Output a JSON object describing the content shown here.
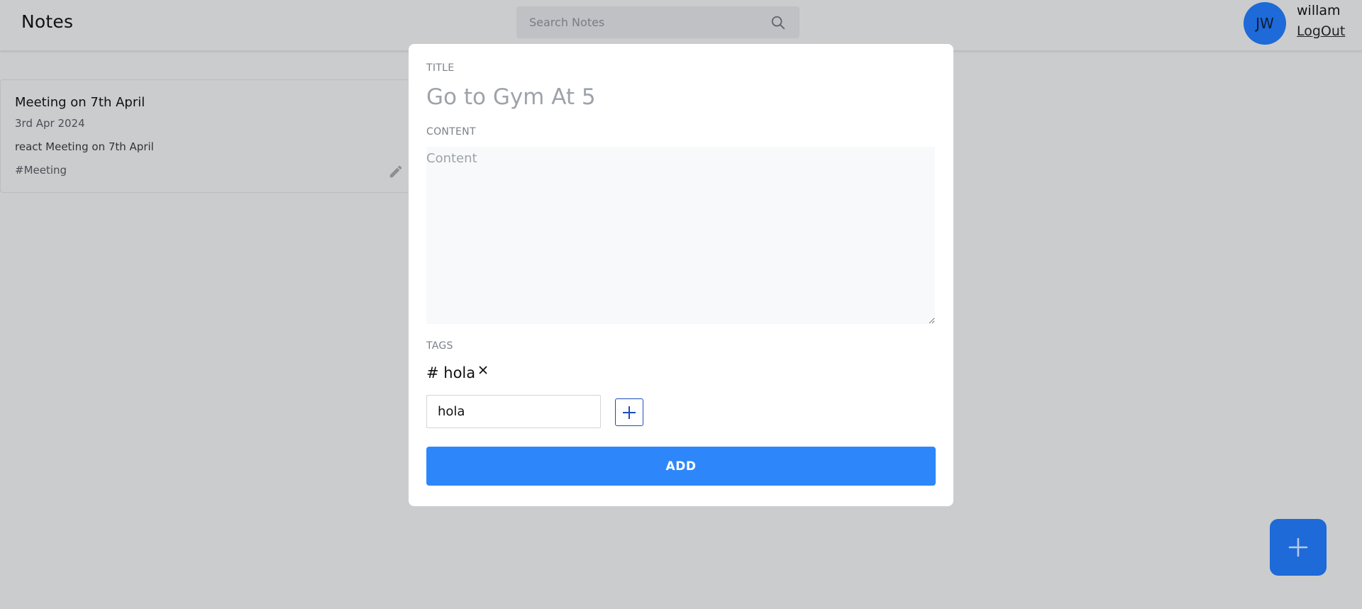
{
  "header": {
    "title": "Notes",
    "search_placeholder": "Search Notes",
    "avatar_initials": "JW",
    "user_name": "willam",
    "logout_label": "LogOut"
  },
  "notes": [
    {
      "title": "Meeting on 7th April",
      "date": "3rd Apr 2024",
      "content": "react Meeting on 7th April",
      "tags": "#Meeting"
    }
  ],
  "modal": {
    "title_label": "TITLE",
    "title_placeholder": "Go to Gym At 5",
    "content_label": "CONTENT",
    "content_placeholder": "Content",
    "tags_label": "TAGS",
    "tags": [
      "# hola"
    ],
    "tag_input_value": "hola",
    "add_label": "ADD"
  },
  "colors": {
    "accent": "#2d87fb",
    "avatar_bg": "#1d6ad8",
    "overlay_bg": "#cbcccd"
  },
  "icons": {
    "search": "search-icon",
    "edit": "pencil-icon",
    "tag_remove": "close-icon",
    "add_tag": "plus-icon",
    "fab": "plus-icon"
  }
}
